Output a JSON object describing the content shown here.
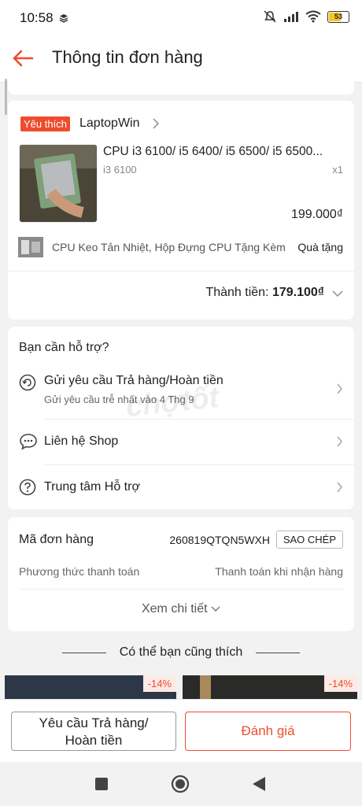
{
  "status": {
    "time": "10:58",
    "battery": "53"
  },
  "header": {
    "title": "Thông tin đơn hàng"
  },
  "shop": {
    "badge": "Yêu thích",
    "name": "LaptopWin"
  },
  "product": {
    "name": "CPU i3 6100/ i5 6400/ i5 6500/ i5 6500...",
    "variant": "i3 6100",
    "qty": "x1",
    "price": "199.000₫"
  },
  "gift": {
    "text": "CPU Keo Tản Nhiệt, Hộp Đựng CPU  Tặng Kèm",
    "label": "Quà tặng"
  },
  "total": {
    "label": "Thành tiền: ",
    "value": "179.100₫"
  },
  "support": {
    "title": "Bạn cần hỗ trợ?",
    "items": [
      {
        "label": "Gửi yêu cầu Trả hàng/Hoàn tiền",
        "sub": "Gửi yêu cầu trễ nhất vào 4 Thg 9",
        "icon": "return-icon"
      },
      {
        "label": "Liên hệ Shop",
        "icon": "chat-icon"
      },
      {
        "label": "Trung tâm Hỗ trợ",
        "icon": "help-icon"
      }
    ]
  },
  "order": {
    "id_label": "Mã đơn hàng",
    "id": "260819QTQN5WXH",
    "copy_label": "SAO CHÉP",
    "payment_label": "Phương thức thanh toán",
    "payment_value": "Thanh toán khi nhận hàng",
    "details_link": "Xem chi tiết"
  },
  "recommend": {
    "title": "Có thể bạn cũng thích",
    "discounts": [
      "-14%",
      "-14%"
    ]
  },
  "watermark": "chợtốt",
  "bottom": {
    "return_line1": "Yêu cầu Trả hàng/",
    "return_line2": "Hoàn tiền",
    "rate": "Đánh giá"
  },
  "colors": {
    "accent": "#ee4d2d"
  }
}
